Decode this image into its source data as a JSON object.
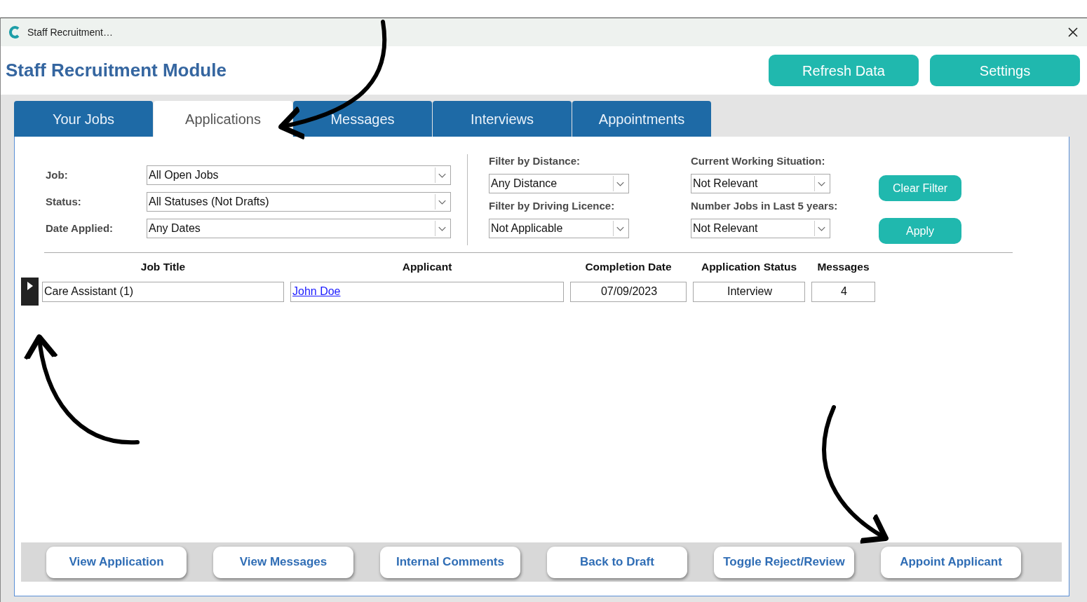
{
  "window": {
    "title": "Staff Recruitment…"
  },
  "header": {
    "title": "Staff Recruitment Module",
    "buttons": [
      "Refresh Data",
      "Settings"
    ]
  },
  "tabs": [
    {
      "label": "Your Jobs",
      "selected": false
    },
    {
      "label": "Applications",
      "selected": true
    },
    {
      "label": "Messages",
      "selected": false
    },
    {
      "label": "Interviews",
      "selected": false
    },
    {
      "label": "Appointments",
      "selected": false
    }
  ],
  "filters_left": [
    {
      "label": "Job:",
      "value": "All Open Jobs"
    },
    {
      "label": "Status:",
      "value": "All Statuses (Not Drafts)"
    },
    {
      "label": "Date Applied:",
      "value": "Any Dates"
    }
  ],
  "filters_middle": [
    {
      "label": "Filter by Distance:",
      "value": "Any Distance"
    },
    {
      "label": "Filter by Driving Licence:",
      "value": "Not Applicable"
    }
  ],
  "filters_right": [
    {
      "label": "Current Working Situation:",
      "value": "Not Relevant"
    },
    {
      "label": "Number Jobs in Last 5 years:",
      "value": "Not Relevant"
    }
  ],
  "filter_buttons": [
    "Clear Filter",
    "Apply"
  ],
  "table": {
    "columns": [
      "Job Title",
      "Applicant",
      "Completion Date",
      "Application Status",
      "Messages"
    ],
    "rows": [
      {
        "job_title": "Care Assistant (1)",
        "applicant": "John Doe",
        "completion_date": "07/09/2023",
        "application_status": "Interview",
        "messages": "4",
        "selected": true
      }
    ]
  },
  "footer_buttons": [
    "View Application",
    "View Messages",
    "Internal Comments",
    "Back to Draft",
    "Toggle Reject/Review",
    "Appoint Applicant"
  ]
}
